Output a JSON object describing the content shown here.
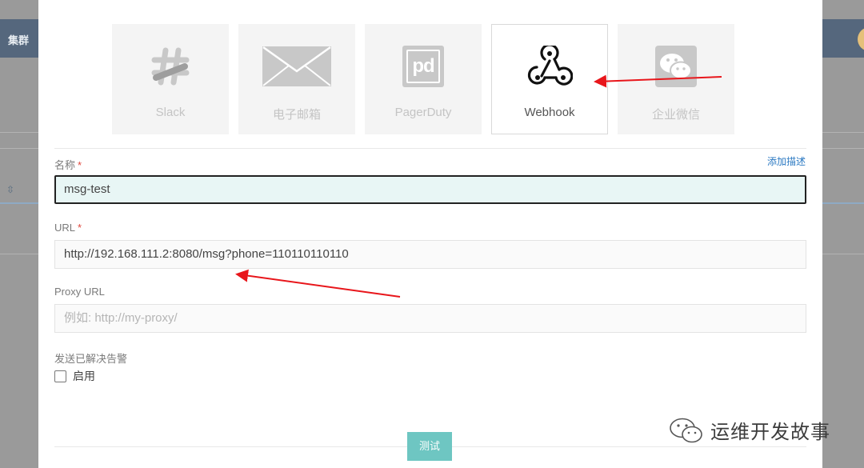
{
  "background": {
    "cluster_tab": "集群"
  },
  "notifiers": [
    {
      "label": "Slack",
      "icon": "slack-icon",
      "selected": false
    },
    {
      "label": "电子邮箱",
      "icon": "email-icon",
      "selected": false
    },
    {
      "label": "PagerDuty",
      "icon": "pagerduty-icon",
      "selected": false
    },
    {
      "label": "Webhook",
      "icon": "webhook-icon",
      "selected": true
    },
    {
      "label": "企业微信",
      "icon": "wechat-work-icon",
      "selected": false
    }
  ],
  "pagerduty_icon_text": "pd",
  "form": {
    "name_label": "名称",
    "required_mark": "*",
    "add_description": "添加描述",
    "name_value": "msg-test",
    "url_label": "URL",
    "url_value": "http://192.168.111.2:8080/msg?phone=110110110110",
    "proxy_label": "Proxy URL",
    "proxy_placeholder": "例如: http://my-proxy/",
    "send_resolved_label": "发送已解决告警",
    "enable_label": "启用",
    "test_button": "测试"
  },
  "watermark": {
    "text": "运维开发故事"
  },
  "colors": {
    "accent": "#6ec6c2",
    "link": "#2b79c2",
    "required": "#e0463c",
    "arrow": "#e8161b"
  }
}
